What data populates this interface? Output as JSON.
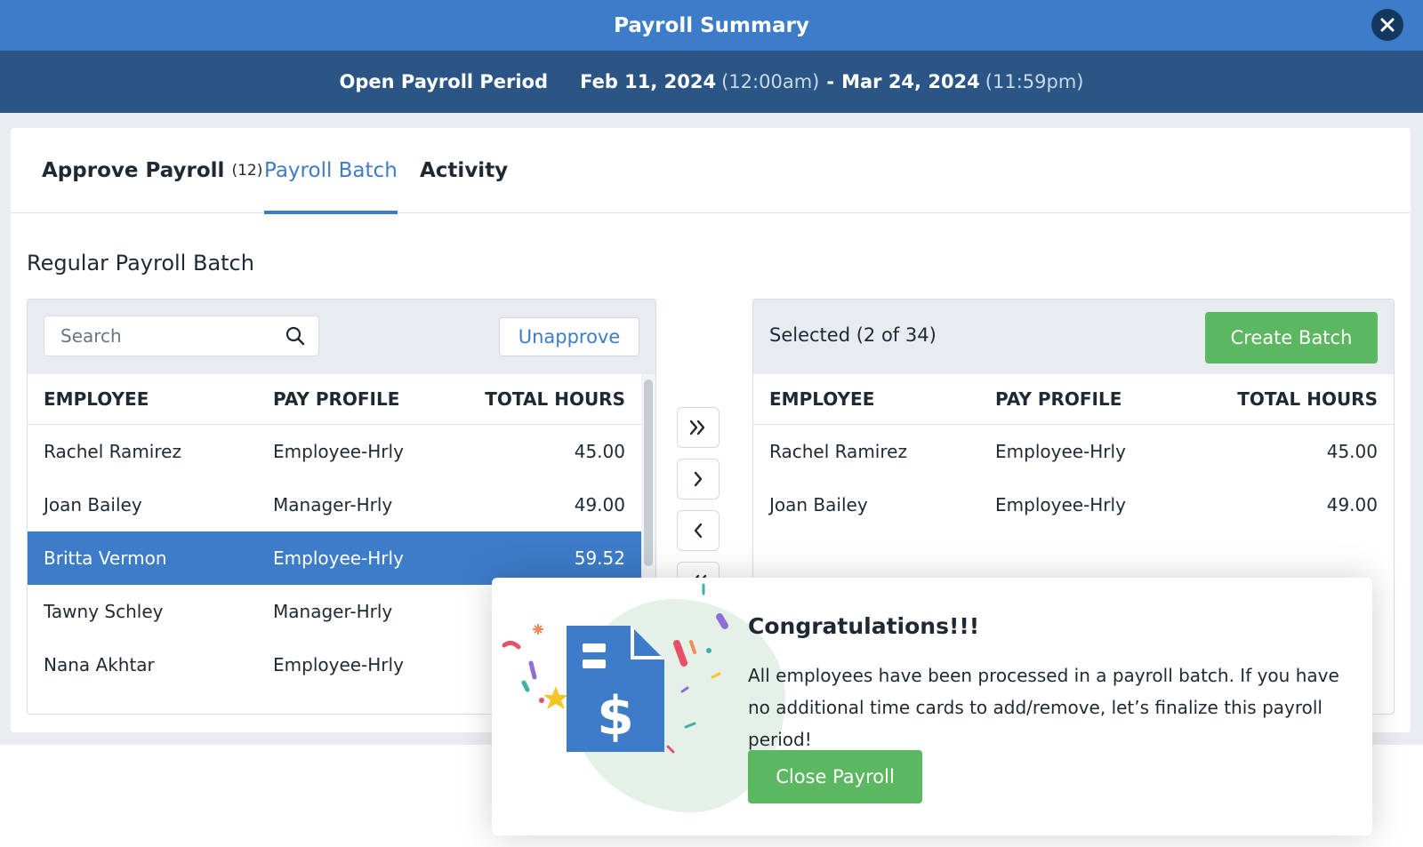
{
  "window": {
    "title": "Payroll Summary"
  },
  "period": {
    "label": "Open Payroll Period",
    "start_date": "Feb 11, 2024",
    "start_time": "(12:00am)",
    "separator": "-",
    "end_date": "Mar 24, 2024",
    "end_time": "(11:59pm)"
  },
  "tabs": [
    {
      "label": "Approve Payroll",
      "count": "(12)"
    },
    {
      "label": "Payroll Batch"
    },
    {
      "label": "Activity"
    }
  ],
  "active_tab": "Payroll Batch",
  "section_title": "Regular Payroll Batch",
  "left_panel": {
    "search_placeholder": "Search",
    "unapprove_label": "Unapprove",
    "columns": [
      "EMPLOYEE",
      "PAY PROFILE",
      "TOTAL HOURS"
    ],
    "rows": [
      {
        "employee": "Rachel Ramirez",
        "profile": "Employee-Hrly",
        "hours": "45.00"
      },
      {
        "employee": "Joan Bailey",
        "profile": "Manager-Hrly",
        "hours": "49.00"
      },
      {
        "employee": "Britta Vermon",
        "profile": "Employee-Hrly",
        "hours": "59.52",
        "selected": true
      },
      {
        "employee": "Tawny Schley",
        "profile": "Manager-Hrly",
        "hours": ""
      },
      {
        "employee": "Nana Akhtar",
        "profile": "Employee-Hrly",
        "hours": ""
      }
    ]
  },
  "right_panel": {
    "selected_label": "Selected (2 of 34)",
    "create_batch_label": "Create Batch",
    "columns": [
      "EMPLOYEE",
      "PAY PROFILE",
      "TOTAL HOURS"
    ],
    "rows": [
      {
        "employee": "Rachel Ramirez",
        "profile": "Employee-Hrly",
        "hours": "45.00"
      },
      {
        "employee": "Joan Bailey",
        "profile": "Employee-Hrly",
        "hours": "49.00"
      }
    ]
  },
  "movers": [
    "move-all-right-icon",
    "move-right-icon",
    "move-left-icon",
    "move-all-left-icon"
  ],
  "popup": {
    "title": "Congratulations!!!",
    "message": "All employees have been processed in a payroll batch. If you have no additional time cards to add/remove, let’s finalize this payroll period!",
    "button_label": "Close Payroll"
  },
  "colors": {
    "title_bar": "#3d7cc8",
    "period_bar": "#2b5584",
    "accent": "#3d7cc8",
    "success": "#5cb860"
  }
}
